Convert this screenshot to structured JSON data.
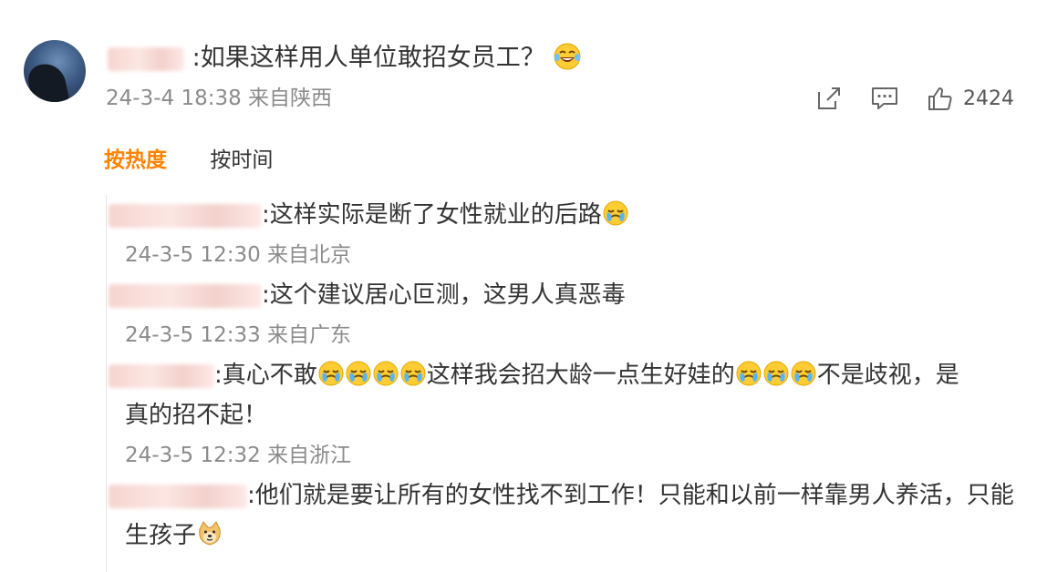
{
  "post": {
    "text": ":如果这样用人单位敢招女员工？",
    "emoji": "laugh-cry-emoji",
    "meta": "24-3-4 18:38 来自陕西",
    "actions": {
      "share_icon": "share-icon",
      "comment_icon": "comment-icon",
      "like_icon": "thumbs-up-icon",
      "like_count": "2424"
    }
  },
  "tabs": {
    "hot": "按热度",
    "time": "按时间",
    "active_color": "#ff8200"
  },
  "replies": [
    {
      "text": ":这样实际是断了女性就业的后路",
      "meta": "24-3-5 12:30 来自北京"
    },
    {
      "text": ":这个建议居心叵测，这男人真恶毒",
      "meta": "24-3-5 12:33 来自广东"
    },
    {
      "text_a": ":真心不敢",
      "text_b": "这样我会招大龄一点生好娃的",
      "text_c": "不是歧视，是",
      "text_d": "真的招不起！",
      "meta": "24-3-5 12:32 来自浙江"
    },
    {
      "text": ":他们就是要让所有的女性找不到工作！只能和以前一样靠男人养活，只能",
      "text_b": "生孩子"
    }
  ]
}
